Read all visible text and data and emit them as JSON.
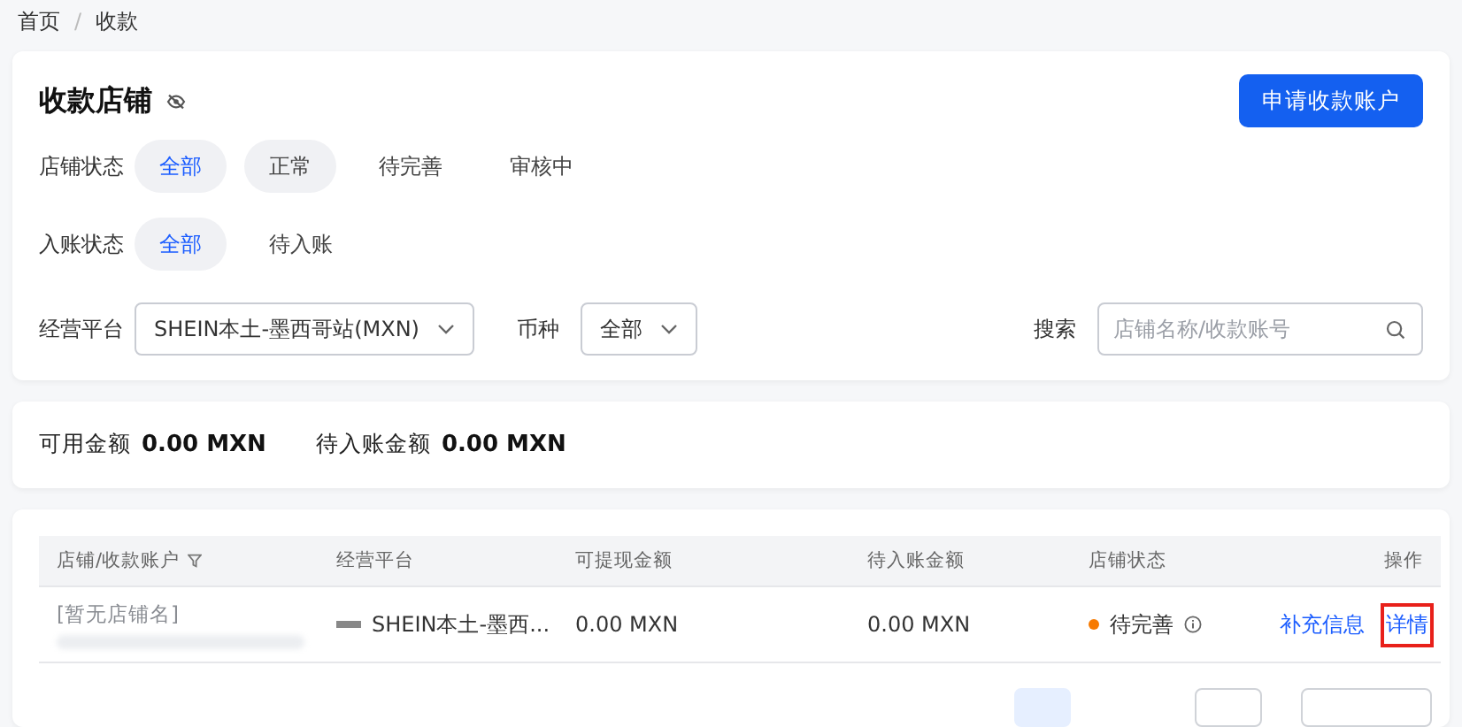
{
  "breadcrumb": {
    "items": [
      "首页",
      "收款"
    ],
    "separator": "/"
  },
  "store_card": {
    "title": "收款店铺",
    "apply_button": "申请收款账户",
    "filters": [
      {
        "label": "店铺状态",
        "options": [
          {
            "label": "全部",
            "selected": true,
            "hovered": false
          },
          {
            "label": "正常",
            "selected": false,
            "hovered": true
          },
          {
            "label": "待完善",
            "selected": false,
            "hovered": false
          },
          {
            "label": "审核中",
            "selected": false,
            "hovered": false
          }
        ]
      },
      {
        "label": "入账状态",
        "options": [
          {
            "label": "全部",
            "selected": true,
            "hovered": false
          },
          {
            "label": "待入账",
            "selected": false,
            "hovered": false
          }
        ]
      }
    ],
    "platform": {
      "label": "经营平台",
      "value": "SHEIN本土-墨西哥站(MXN)"
    },
    "currency": {
      "label": "币种",
      "value": "全部"
    },
    "search": {
      "label": "搜索",
      "placeholder": "店铺名称/收款账号"
    }
  },
  "balances": [
    {
      "label": "可用金额",
      "value": "0.00 MXN"
    },
    {
      "label": "待入账金额",
      "value": "0.00 MXN"
    }
  ],
  "table": {
    "columns": [
      "店铺/收款账户",
      "经营平台",
      "可提现金额",
      "待入账金额",
      "店铺状态",
      "操作"
    ],
    "rows": [
      {
        "store": "[暂无店铺名]",
        "platform": "SHEIN本土-墨西...",
        "withdrawable": "0.00 MXN",
        "pending": "0.00 MXN",
        "status": {
          "text": "待完善",
          "color": "#f77a00"
        },
        "actions": [
          {
            "label": "补充信息",
            "highlighted": false
          },
          {
            "label": "详情",
            "highlighted": true
          }
        ]
      }
    ]
  }
}
